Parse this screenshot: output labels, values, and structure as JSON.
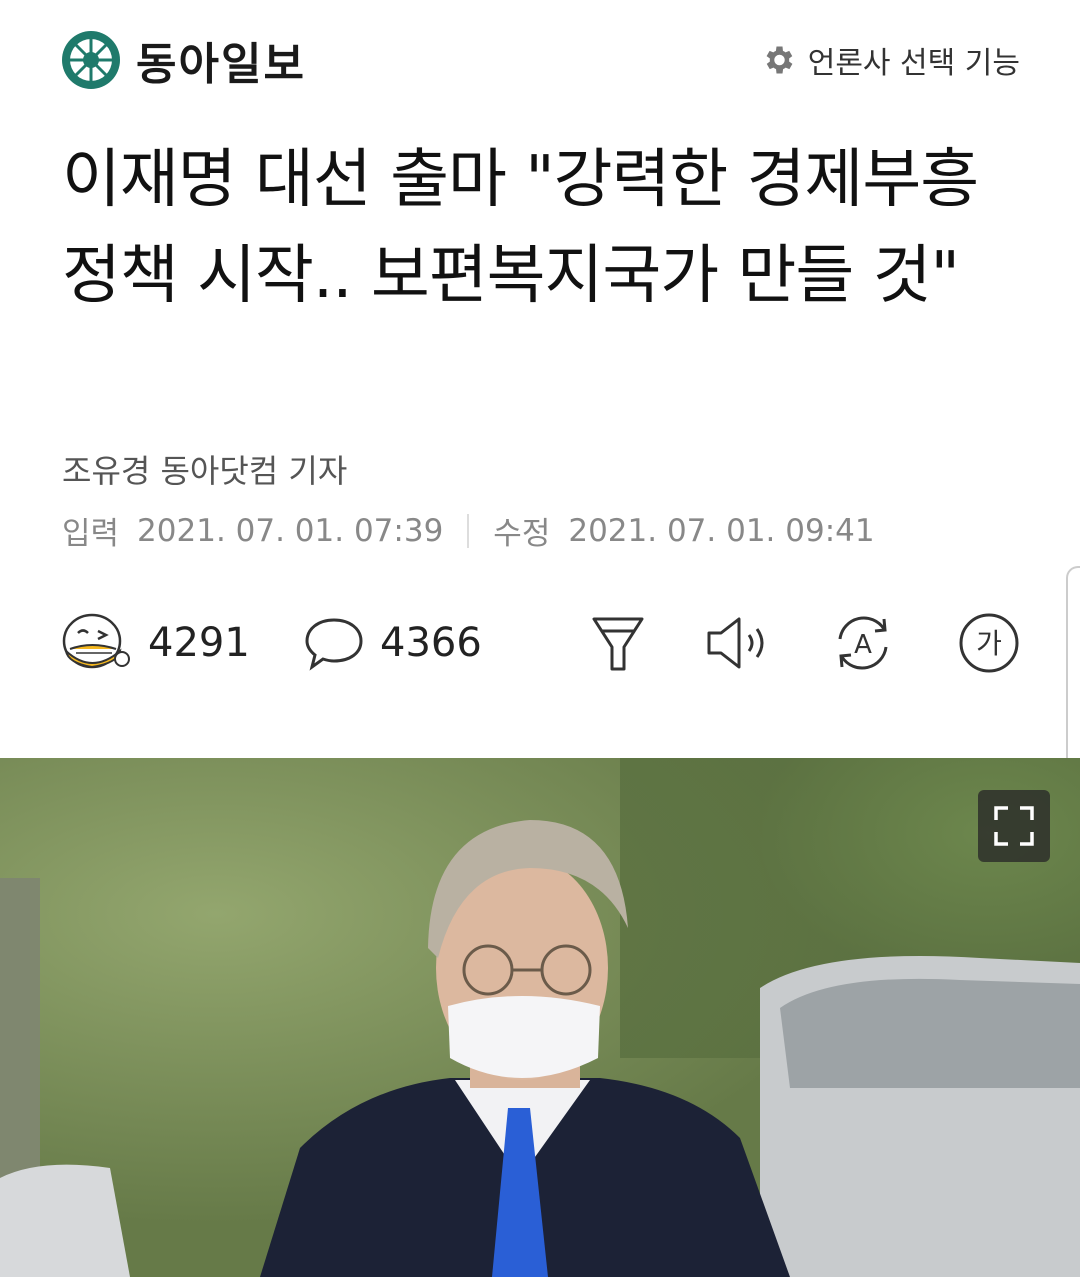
{
  "header": {
    "logo_text": "동아일보",
    "press_select_label": "언론사 선택 기능"
  },
  "article": {
    "headline": "이재명 대선 출마 \"강력한 경제부흥정책 시작.. 보편복지국가 만들 것\"",
    "reporter": "조유경 동아닷컴 기자",
    "input_label": "입력",
    "input_time": "2021. 07. 01. 07:39",
    "modified_label": "수정",
    "modified_time": "2021. 07. 01. 09:41"
  },
  "toolbar": {
    "reaction_count": "4291",
    "comment_count": "4366",
    "icons": [
      "reaction-emoji-icon",
      "comment-icon",
      "summary-filter-icon",
      "audio-read-icon",
      "translate-icon",
      "font-size-icon"
    ],
    "font_size_label": "가",
    "translate_label": "A"
  },
  "colors": {
    "logo_green": "#1f7a6b",
    "text_dark": "#111111",
    "text_gray": "#888888",
    "reaction_yellow": "#f5b820"
  }
}
